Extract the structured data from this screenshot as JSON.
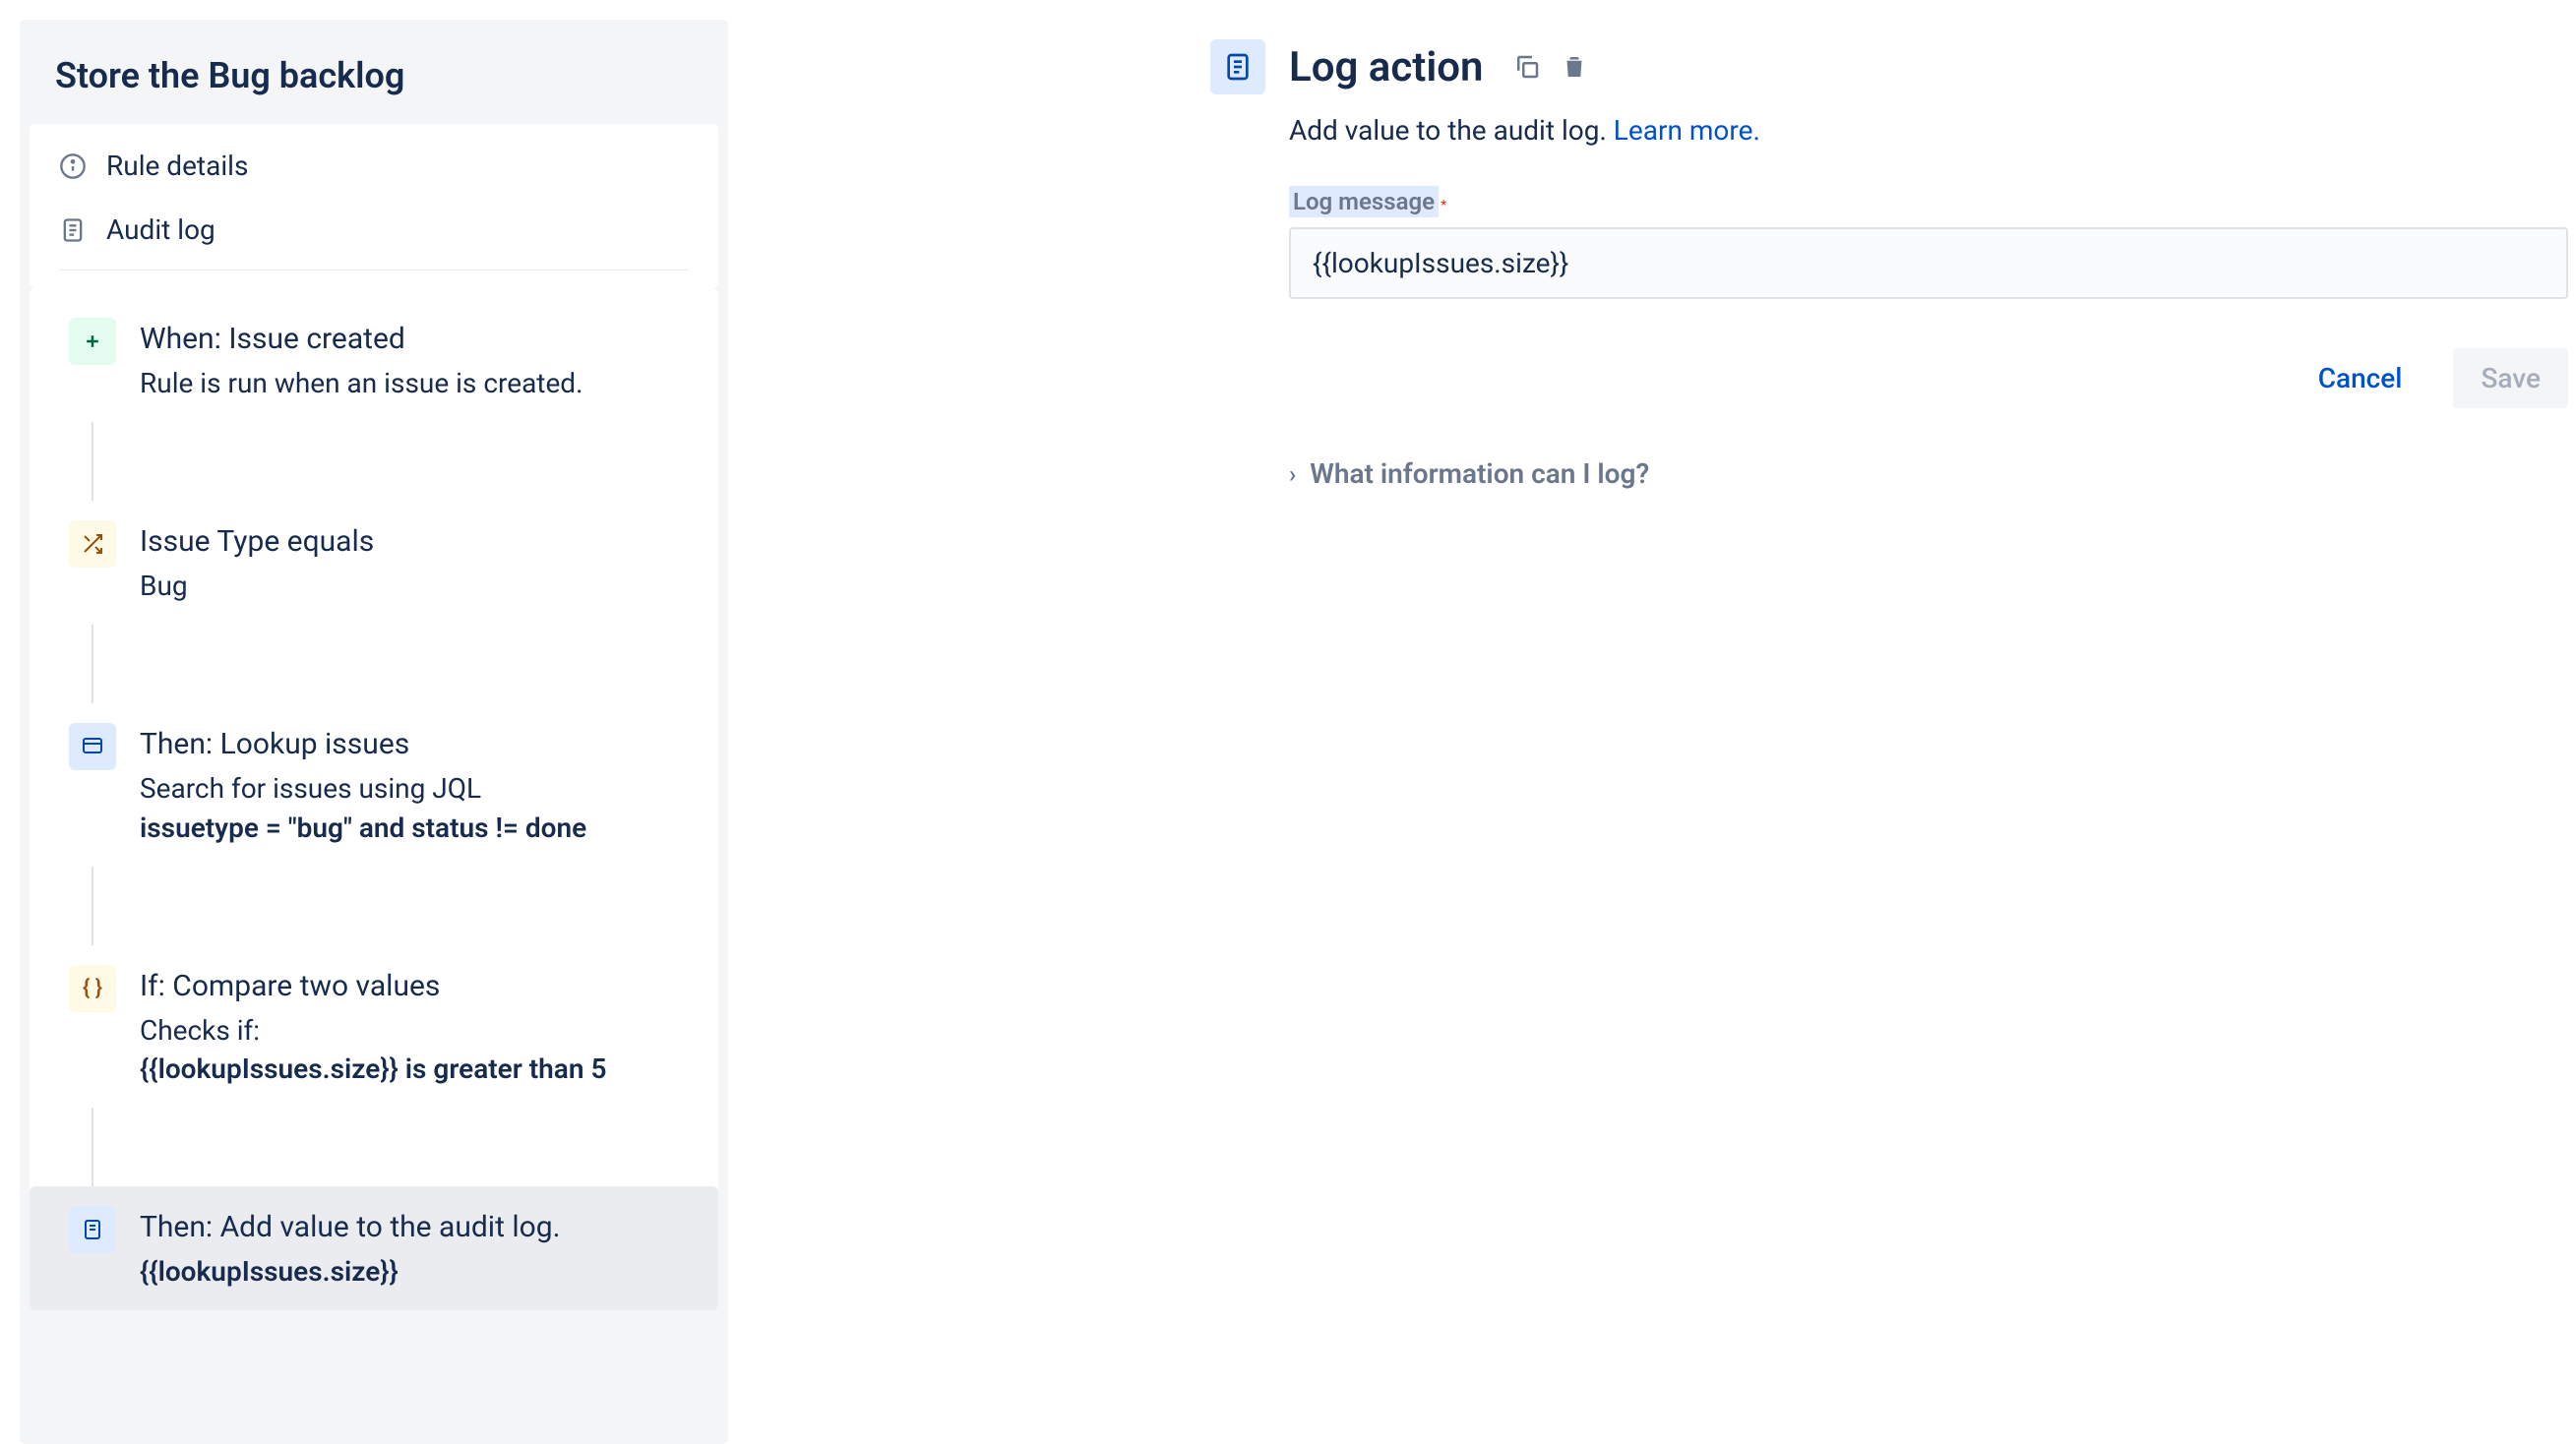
{
  "sidebar": {
    "title": "Store the Bug backlog",
    "links": [
      {
        "label": "Rule details"
      },
      {
        "label": "Audit log"
      }
    ],
    "steps": [
      {
        "title": "When: Issue created",
        "desc": "Rule is run when an issue is created.",
        "bold": ""
      },
      {
        "title": "Issue Type equals",
        "desc": "Bug",
        "bold": ""
      },
      {
        "title": "Then: Lookup issues",
        "desc": "Search for issues using JQL",
        "bold": "issuetype = \"bug\" and status != done"
      },
      {
        "title": "If: Compare two values",
        "desc": "Checks if:",
        "bold": "{{lookupIssues.size}} is greater than 5"
      },
      {
        "title": "Then: Add value to the audit log.",
        "desc": "",
        "bold": "{{lookupIssues.size}}"
      }
    ]
  },
  "main": {
    "title": "Log action",
    "desc_prefix": "Add value to the audit log. ",
    "learn_more": "Learn more.",
    "field_label": "Log message",
    "input_value": "{{lookupIssues.size}}",
    "cancel_label": "Cancel",
    "save_label": "Save",
    "collapsible": "What information can I log?"
  }
}
